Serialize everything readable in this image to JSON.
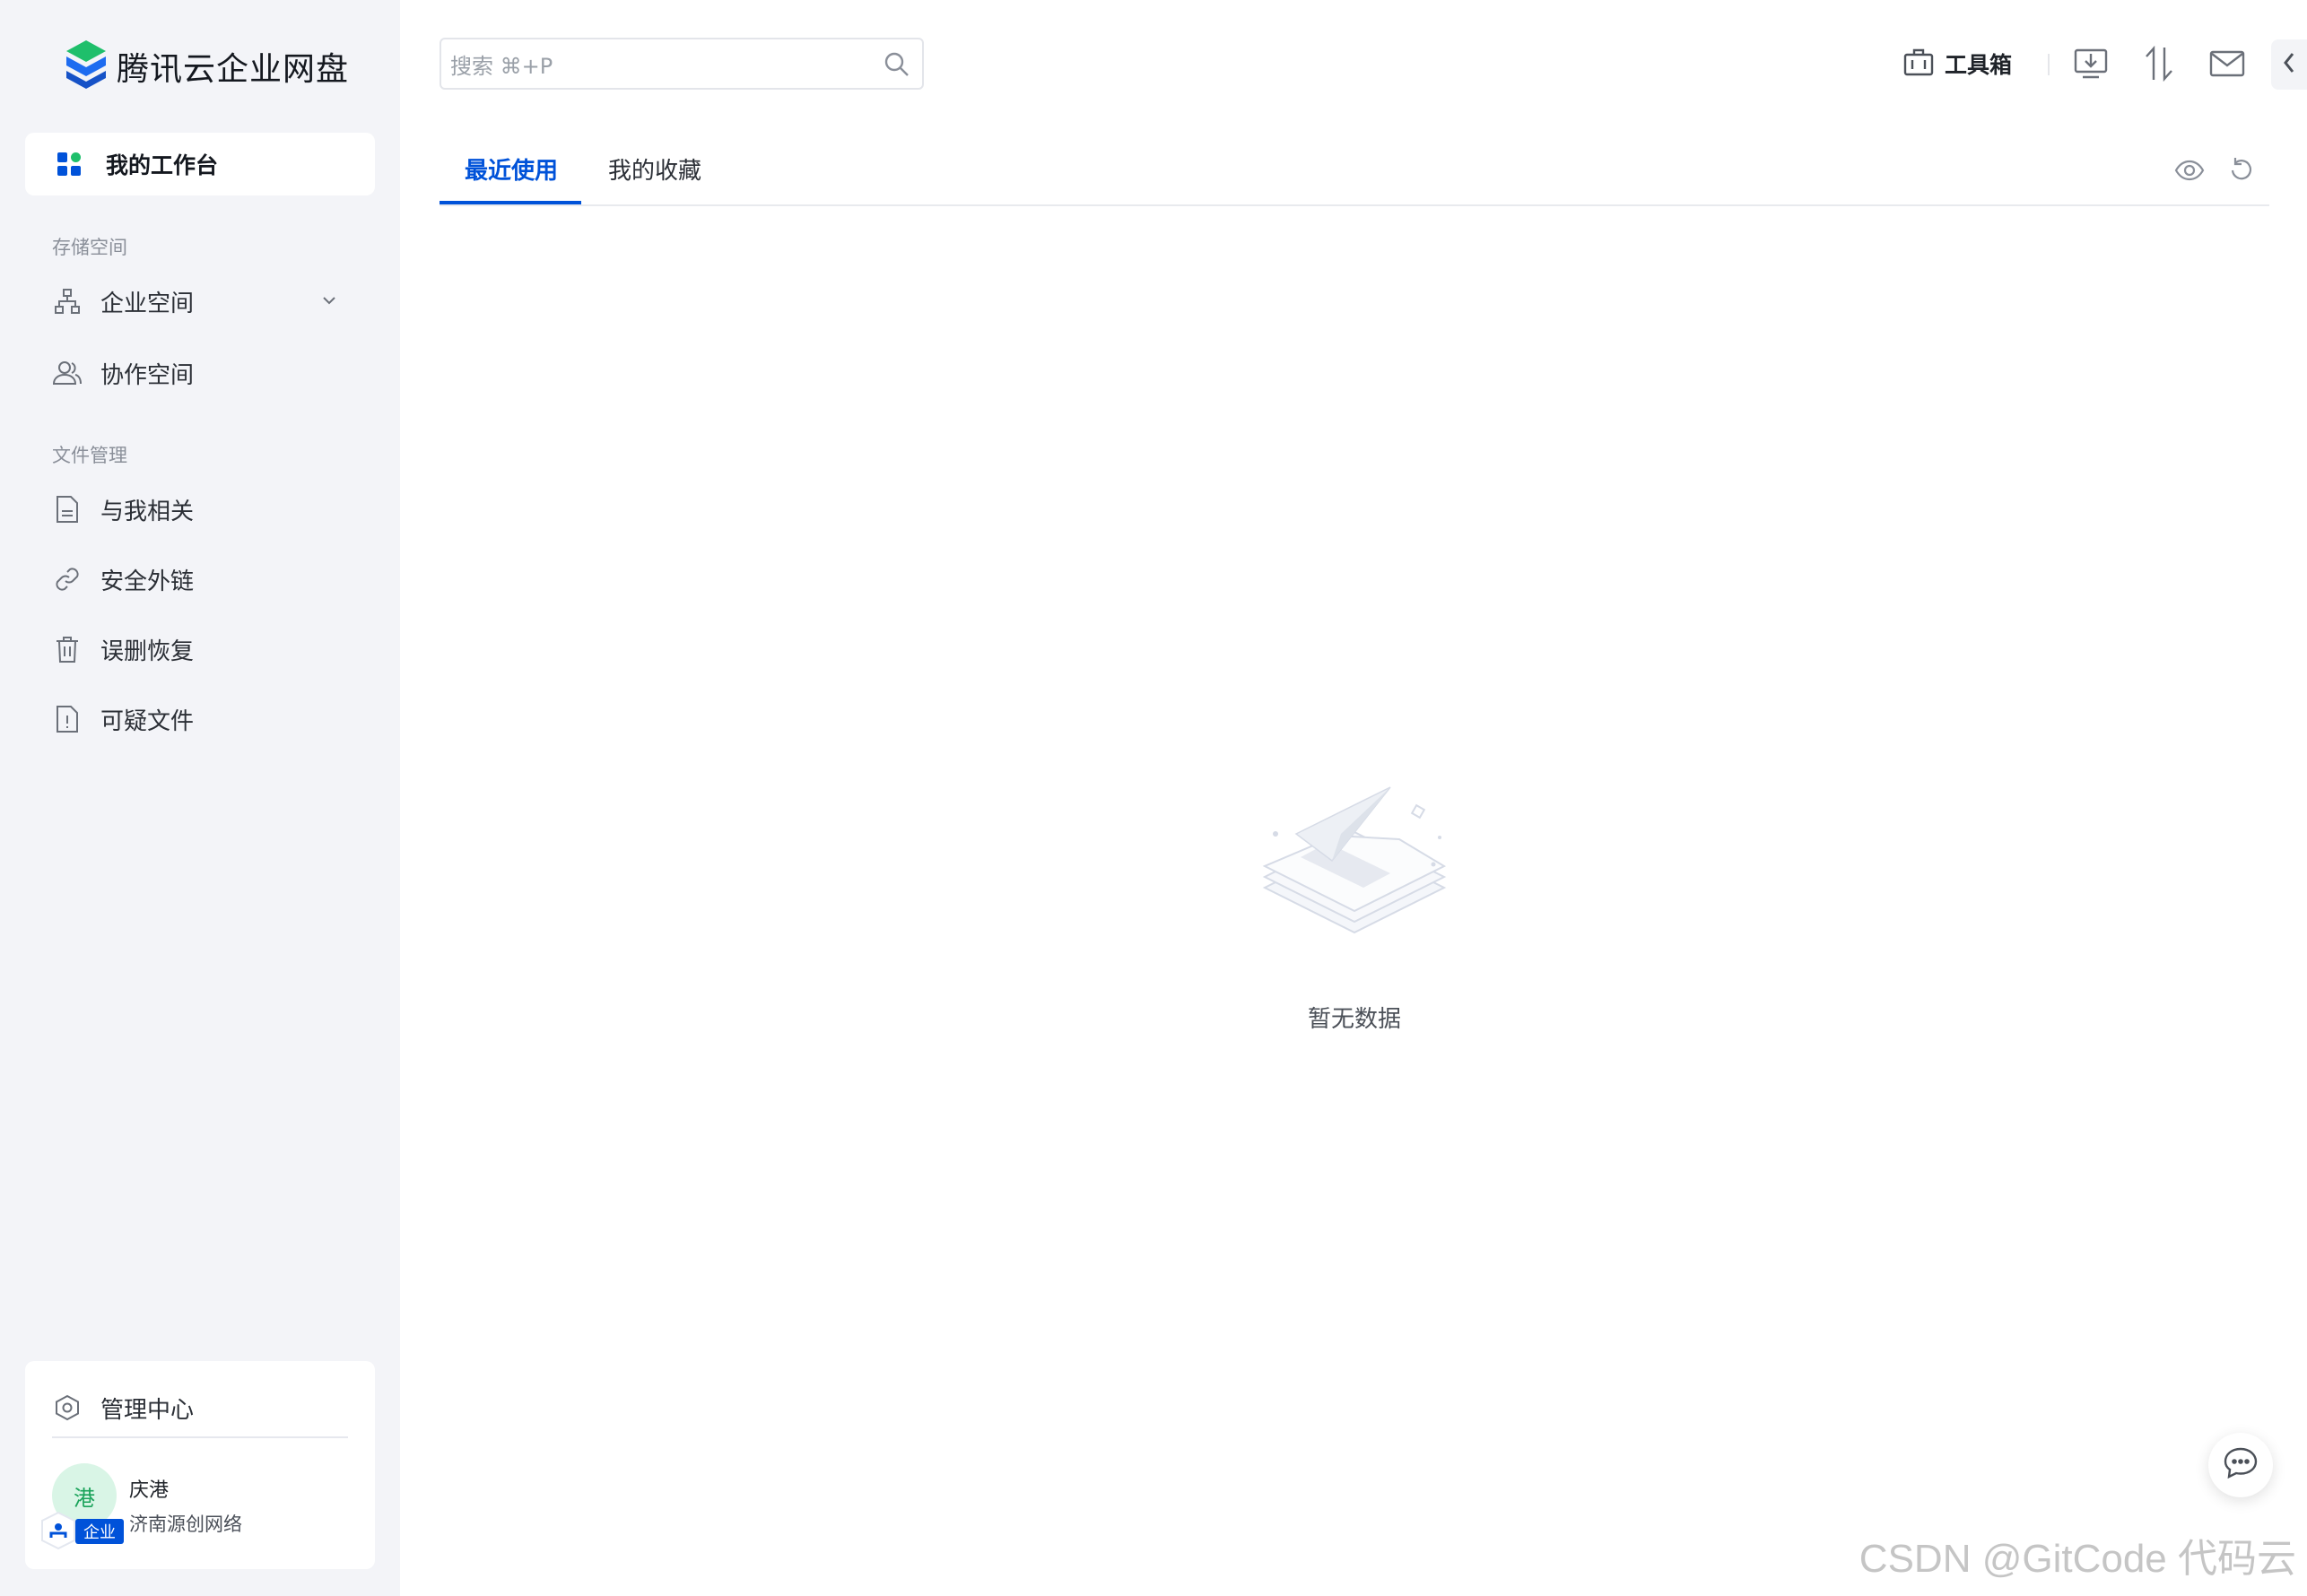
{
  "app": {
    "name": "腾讯云企业网盘"
  },
  "sidebar": {
    "workbench": "我的工作台",
    "storage_title": "存储空间",
    "storage_items": [
      {
        "label": "企业空间",
        "icon": "org-tree-icon",
        "expandable": true
      },
      {
        "label": "协作空间",
        "icon": "users-icon"
      }
    ],
    "files_title": "文件管理",
    "file_items": [
      {
        "label": "与我相关",
        "icon": "document-icon"
      },
      {
        "label": "安全外链",
        "icon": "link-icon"
      },
      {
        "label": "误删恢复",
        "icon": "trash-icon"
      },
      {
        "label": "可疑文件",
        "icon": "suspicious-file-icon"
      }
    ],
    "admin": "管理中心",
    "user": {
      "avatar": "港",
      "name": "庆港",
      "org": "济南源创网络",
      "badge": "企业"
    }
  },
  "header": {
    "search_placeholder": "搜索 ⌘+P",
    "toolbox": "工具箱",
    "icons": [
      "download-icon",
      "transfer-icon",
      "mail-icon",
      "collapse-icon"
    ]
  },
  "tabs": [
    {
      "label": "最近使用",
      "active": true
    },
    {
      "label": "我的收藏",
      "active": false
    }
  ],
  "content": {
    "empty_text": "暂无数据"
  },
  "watermark": "CSDN @GitCode 代码云"
}
